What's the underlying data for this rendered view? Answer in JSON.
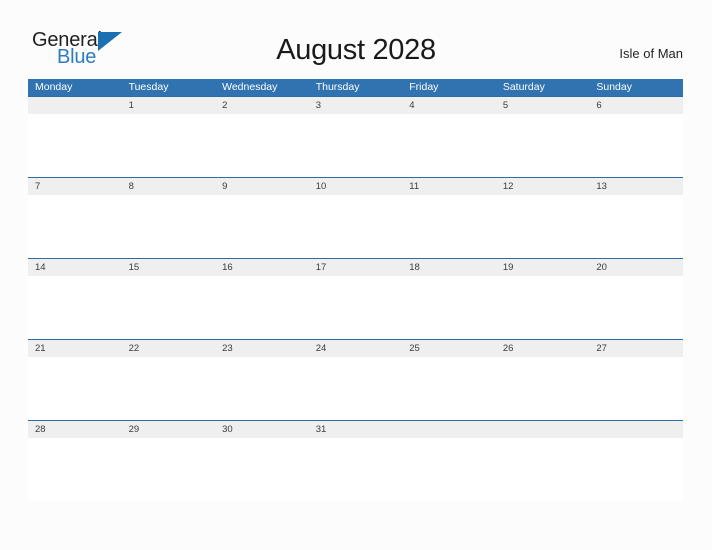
{
  "logo": {
    "line1": "General",
    "line2": "Blue",
    "flag_icon": "blue-flag-triangle-icon",
    "color_dark": "#231f20",
    "color_blue": "#2b7cc3"
  },
  "header": {
    "title": "August 2028",
    "region": "Isle of Man"
  },
  "calendar": {
    "colors": {
      "header_blue": "#3173b0",
      "row_rule_blue": "#2e6da4",
      "date_band_gray": "#efefef",
      "page_background": "#fcfcfc",
      "header_text": "#ffffff",
      "date_text": "#3b3b3b"
    },
    "weekdays": [
      "Monday",
      "Tuesday",
      "Wednesday",
      "Thursday",
      "Friday",
      "Saturday",
      "Sunday"
    ],
    "weeks": [
      [
        "",
        "1",
        "2",
        "3",
        "4",
        "5",
        "6"
      ],
      [
        "7",
        "8",
        "9",
        "10",
        "11",
        "12",
        "13"
      ],
      [
        "14",
        "15",
        "16",
        "17",
        "18",
        "19",
        "20"
      ],
      [
        "21",
        "22",
        "23",
        "24",
        "25",
        "26",
        "27"
      ],
      [
        "28",
        "29",
        "30",
        "31",
        "",
        "",
        ""
      ]
    ]
  }
}
